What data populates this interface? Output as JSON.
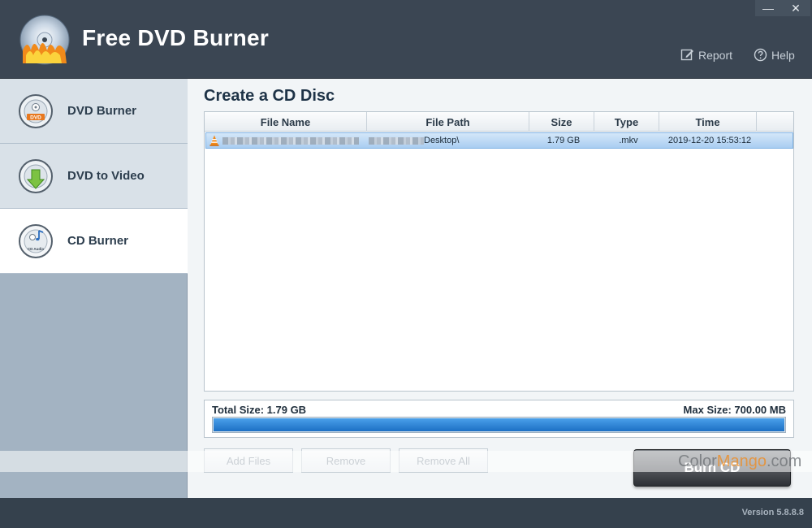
{
  "app": {
    "title": "Free DVD Burner",
    "window_controls": {
      "minimize": "—",
      "close": "✕"
    }
  },
  "toolbar": {
    "report_label": "Report",
    "help_label": "Help"
  },
  "sidebar": {
    "items": [
      {
        "label": "DVD Burner",
        "icon": "dvd-disc-icon",
        "active": false
      },
      {
        "label": "DVD to Video",
        "icon": "dvd-download-icon",
        "active": false
      },
      {
        "label": "CD Burner",
        "icon": "cd-audio-icon",
        "active": true
      }
    ],
    "icon_texts": {
      "dvd": "DVD",
      "cd_audio": "CD Audio"
    }
  },
  "main": {
    "title": "Create a CD Disc",
    "table": {
      "columns": [
        "File Name",
        "File Path",
        "Size",
        "Type",
        "Time"
      ],
      "rows": [
        {
          "file_path_suffix": "Desktop\\",
          "size": "1.79 GB",
          "type": ".mkv",
          "time": "2019-12-20 15:53:12",
          "selected": true,
          "icon": "vlc-cone-icon"
        }
      ]
    },
    "total_size": "Total Size: 1.79 GB",
    "max_size": "Max Size: 700.00 MB",
    "progress": 1.0,
    "buttons": {
      "add_files": "Add Files",
      "remove": "Remove",
      "remove_all": "Remove All",
      "burn_cd": "Burn CD"
    }
  },
  "watermark": {
    "part1": "Color",
    "part2": "Mango",
    "part3": ".com"
  },
  "footer": {
    "version": "Version 5.8.8.8"
  },
  "colors": {
    "titlebar": "#3b4653",
    "sidebar": "#a3b3c2",
    "selection": "#a9cdf1",
    "progress": "#1c6fc4"
  }
}
